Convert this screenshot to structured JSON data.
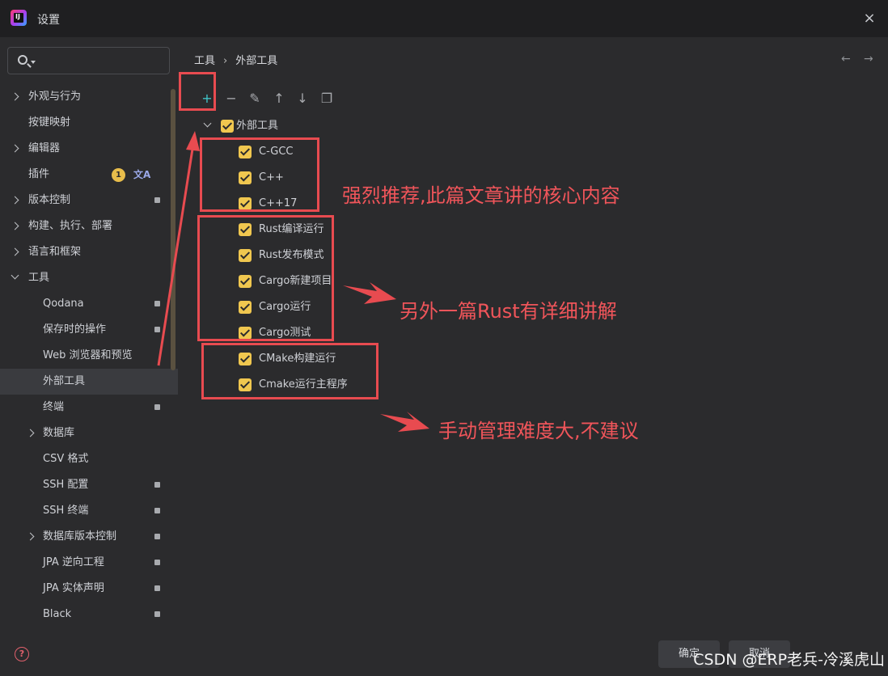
{
  "window": {
    "title": "设置",
    "close_icon": "×"
  },
  "search": {
    "placeholder": ""
  },
  "sidebar": {
    "items": [
      {
        "label": "外观与行为"
      },
      {
        "label": "按键映射"
      },
      {
        "label": "编辑器"
      },
      {
        "label": "插件",
        "badge": "1",
        "translate_glyph": "文A"
      },
      {
        "label": "版本控制"
      },
      {
        "label": "构建、执行、部署"
      },
      {
        "label": "语言和框架"
      },
      {
        "label": "工具"
      },
      {
        "label": "Qodana"
      },
      {
        "label": "保存时的操作"
      },
      {
        "label": "Web 浏览器和预览"
      },
      {
        "label": "外部工具"
      },
      {
        "label": "终端"
      },
      {
        "label": "数据库"
      },
      {
        "label": "CSV 格式"
      },
      {
        "label": "SSH 配置"
      },
      {
        "label": "SSH 终端"
      },
      {
        "label": "数据库版本控制"
      },
      {
        "label": "JPA 逆向工程"
      },
      {
        "label": "JPA 实体声明"
      },
      {
        "label": "Black"
      }
    ]
  },
  "breadcrumb": {
    "parent": "工具",
    "separator": "›",
    "current": "外部工具"
  },
  "toolbar": {
    "add": "+",
    "remove": "−",
    "edit": "✎",
    "up": "↑",
    "down": "↓",
    "copy": "❐"
  },
  "nav_arrows": {
    "back": "←",
    "forward": "→"
  },
  "tree": {
    "root": "外部工具",
    "children": [
      "C-GCC",
      "C++",
      "C++17",
      "Rust编译运行",
      "Rust发布模式",
      "Cargo新建项目",
      "Cargo运行",
      "Cargo测试",
      "CMake构建运行",
      "Cmake运行主程序"
    ]
  },
  "annotations": {
    "note1": "强烈推荐,此篇文章讲的核心内容",
    "note2": "另外一篇Rust有详细讲解",
    "note3": "手动管理难度大,不建议",
    "color": "#e84b50"
  },
  "footer": {
    "ok": "确定",
    "cancel": "取消"
  },
  "watermark": "CSDN @ERP老兵-冷溪虎山",
  "colors": {
    "accent_checkbox": "#f0c74f",
    "background": "#2b2b2d",
    "titlebar": "#1f1f21"
  }
}
